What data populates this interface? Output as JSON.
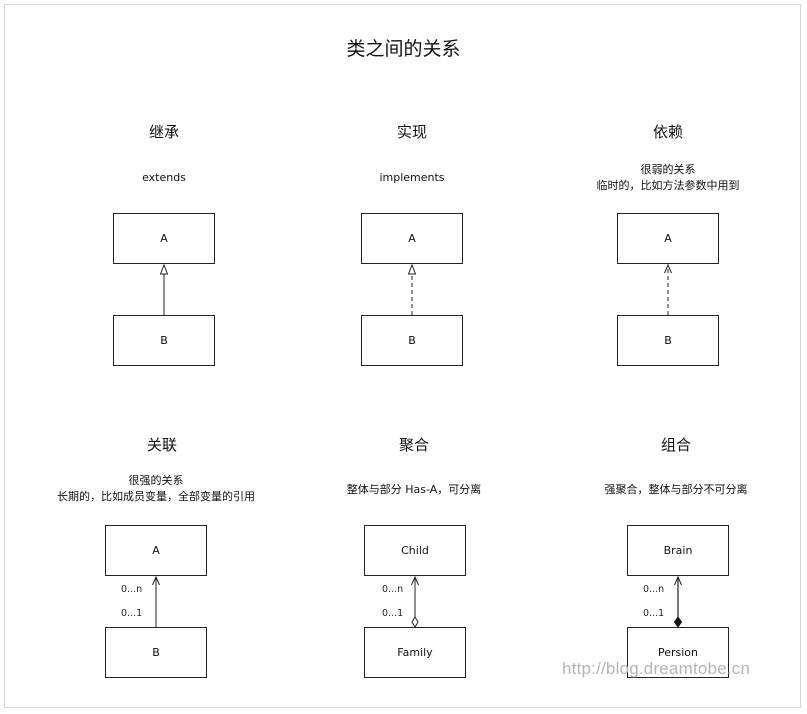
{
  "title": "类之间的关系",
  "panels": [
    {
      "heading": "继承",
      "desc": [
        "extends"
      ],
      "top_box": "A",
      "bottom_box": "B"
    },
    {
      "heading": "实现",
      "desc": [
        "implements"
      ],
      "top_box": "A",
      "bottom_box": "B"
    },
    {
      "heading": "依赖",
      "desc": [
        "很弱的关系",
        "临时的，比如方法参数中用到"
      ],
      "top_box": "A",
      "bottom_box": "B"
    },
    {
      "heading": "关联",
      "desc": [
        "很强的关系",
        "长期的，比如成员变量，全部变量的引用"
      ],
      "top_box": "A",
      "bottom_box": "B",
      "mult_top": "0...n",
      "mult_bottom": "0...1"
    },
    {
      "heading": "聚合",
      "desc": [
        "整体与部分 Has-A，可分离"
      ],
      "top_box": "Child",
      "bottom_box": "Family",
      "mult_top": "0...n",
      "mult_bottom": "0...1"
    },
    {
      "heading": "组合",
      "desc": [
        "强聚合，整体与部分不可分离"
      ],
      "top_box": "Brain",
      "bottom_box": "Persion",
      "mult_top": "0...n",
      "mult_bottom": "0...1"
    }
  ],
  "watermark": "http://blog.dreamtobe.cn"
}
